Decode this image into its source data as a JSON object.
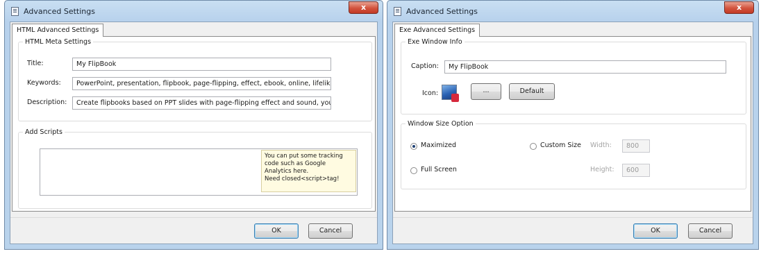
{
  "left_dialog": {
    "title": "Advanced Settings",
    "close_glyph": "x",
    "tab_label": "HTML Advanced Settings",
    "meta_group": {
      "legend": "HTML Meta Settings",
      "title_label": "Title:",
      "title_value": "My FlipBook",
      "keywords_label": "Keywords:",
      "keywords_value": "PowerPoint, presentation, flipbook, page-flipping, effect, ebook, online, lifelik",
      "description_label": "Description:",
      "description_value": "Create flipbooks based on PPT slides with page-flipping effect and sound, you"
    },
    "scripts_group": {
      "legend": "Add Scripts",
      "script_value": "",
      "tip_line1": "You can put some tracking",
      "tip_line2": "code such as Google",
      "tip_line3": "Analytics here.",
      "tip_line4": "Need closed<script>tag!"
    },
    "ok_label": "OK",
    "cancel_label": "Cancel"
  },
  "right_dialog": {
    "title": "Advanced Settings",
    "close_glyph": "x",
    "tab_label": "Exe Advanced Settings",
    "window_info_group": {
      "legend": "Exe Window Info",
      "caption_label": "Caption:",
      "caption_value": "My FlipBook",
      "icon_label": "Icon:",
      "icon_name": "flipbook-app-icon",
      "browse_label": "...",
      "default_label": "Default"
    },
    "window_size_group": {
      "legend": "Window Size Option",
      "maximized_label": "Maximized",
      "maximized_selected": true,
      "custom_size_label": "Custom Size",
      "custom_size_selected": false,
      "full_screen_label": "Full Screen",
      "full_screen_selected": false,
      "width_label": "Width:",
      "width_value": "800",
      "height_label": "Height:",
      "height_value": "600"
    },
    "ok_label": "OK",
    "cancel_label": "Cancel"
  }
}
